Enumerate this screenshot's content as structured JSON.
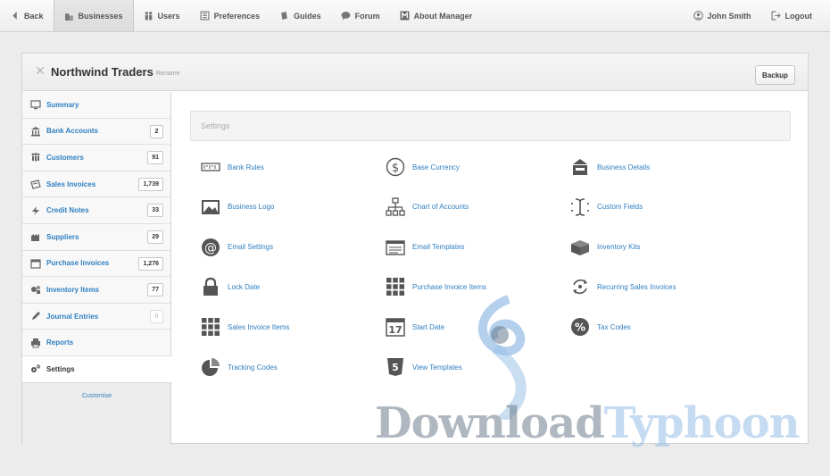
{
  "topbar": {
    "back": "Back",
    "businesses": "Businesses",
    "users": "Users",
    "preferences": "Preferences",
    "guides": "Guides",
    "forum": "Forum",
    "about": "About Manager",
    "user": "John Smith",
    "logout": "Logout"
  },
  "business": {
    "name": "Northwind Traders",
    "rename": "Rename",
    "backup": "Backup"
  },
  "sidebar": {
    "items": [
      {
        "label": "Summary",
        "count": null,
        "icon": "monitor-icon"
      },
      {
        "label": "Bank Accounts",
        "count": "2",
        "icon": "bank-icon"
      },
      {
        "label": "Customers",
        "count": "91",
        "icon": "people-icon"
      },
      {
        "label": "Sales Invoices",
        "count": "1,739",
        "icon": "invoice-icon"
      },
      {
        "label": "Credit Notes",
        "count": "33",
        "icon": "bolt-icon"
      },
      {
        "label": "Suppliers",
        "count": "29",
        "icon": "factory-icon"
      },
      {
        "label": "Purchase Invoices",
        "count": "1,276",
        "icon": "calendar-icon"
      },
      {
        "label": "Inventory Items",
        "count": "77",
        "icon": "items-icon"
      },
      {
        "label": "Journal Entries",
        "count": "0",
        "icon": "pen-icon"
      },
      {
        "label": "Reports",
        "count": null,
        "icon": "printer-icon"
      },
      {
        "label": "Settings",
        "count": null,
        "icon": "gears-icon"
      }
    ],
    "customise": "Customise"
  },
  "settings": {
    "header": "Settings",
    "items": [
      {
        "label": "Bank Rules",
        "icon": "bank-rules-icon"
      },
      {
        "label": "Base Currency",
        "icon": "dollar-icon"
      },
      {
        "label": "Business Details",
        "icon": "storefront-icon"
      },
      {
        "label": "Business Logo",
        "icon": "image-icon"
      },
      {
        "label": "Chart of Accounts",
        "icon": "hierarchy-icon"
      },
      {
        "label": "Custom Fields",
        "icon": "text-cursor-icon"
      },
      {
        "label": "Email Settings",
        "icon": "at-sign-icon"
      },
      {
        "label": "Email Templates",
        "icon": "email-template-icon"
      },
      {
        "label": "Inventory Kits",
        "icon": "box-icon"
      },
      {
        "label": "Lock Date",
        "icon": "lock-icon"
      },
      {
        "label": "Purchase Invoice Items",
        "icon": "grid-icon"
      },
      {
        "label": "Recurring Sales Invoices",
        "icon": "recurring-icon"
      },
      {
        "label": "Sales Invoice Items",
        "icon": "grid-icon"
      },
      {
        "label": "Start Date",
        "icon": "calendar-17-icon"
      },
      {
        "label": "Tax Codes",
        "icon": "percent-icon"
      },
      {
        "label": "Tracking Codes",
        "icon": "pie-icon"
      },
      {
        "label": "View Templates",
        "icon": "html5-icon"
      }
    ]
  },
  "watermark": {
    "part1": "Download",
    "part2": "Typhoon"
  },
  "colors": {
    "link": "#2f7fc1",
    "icon": "#555555"
  }
}
